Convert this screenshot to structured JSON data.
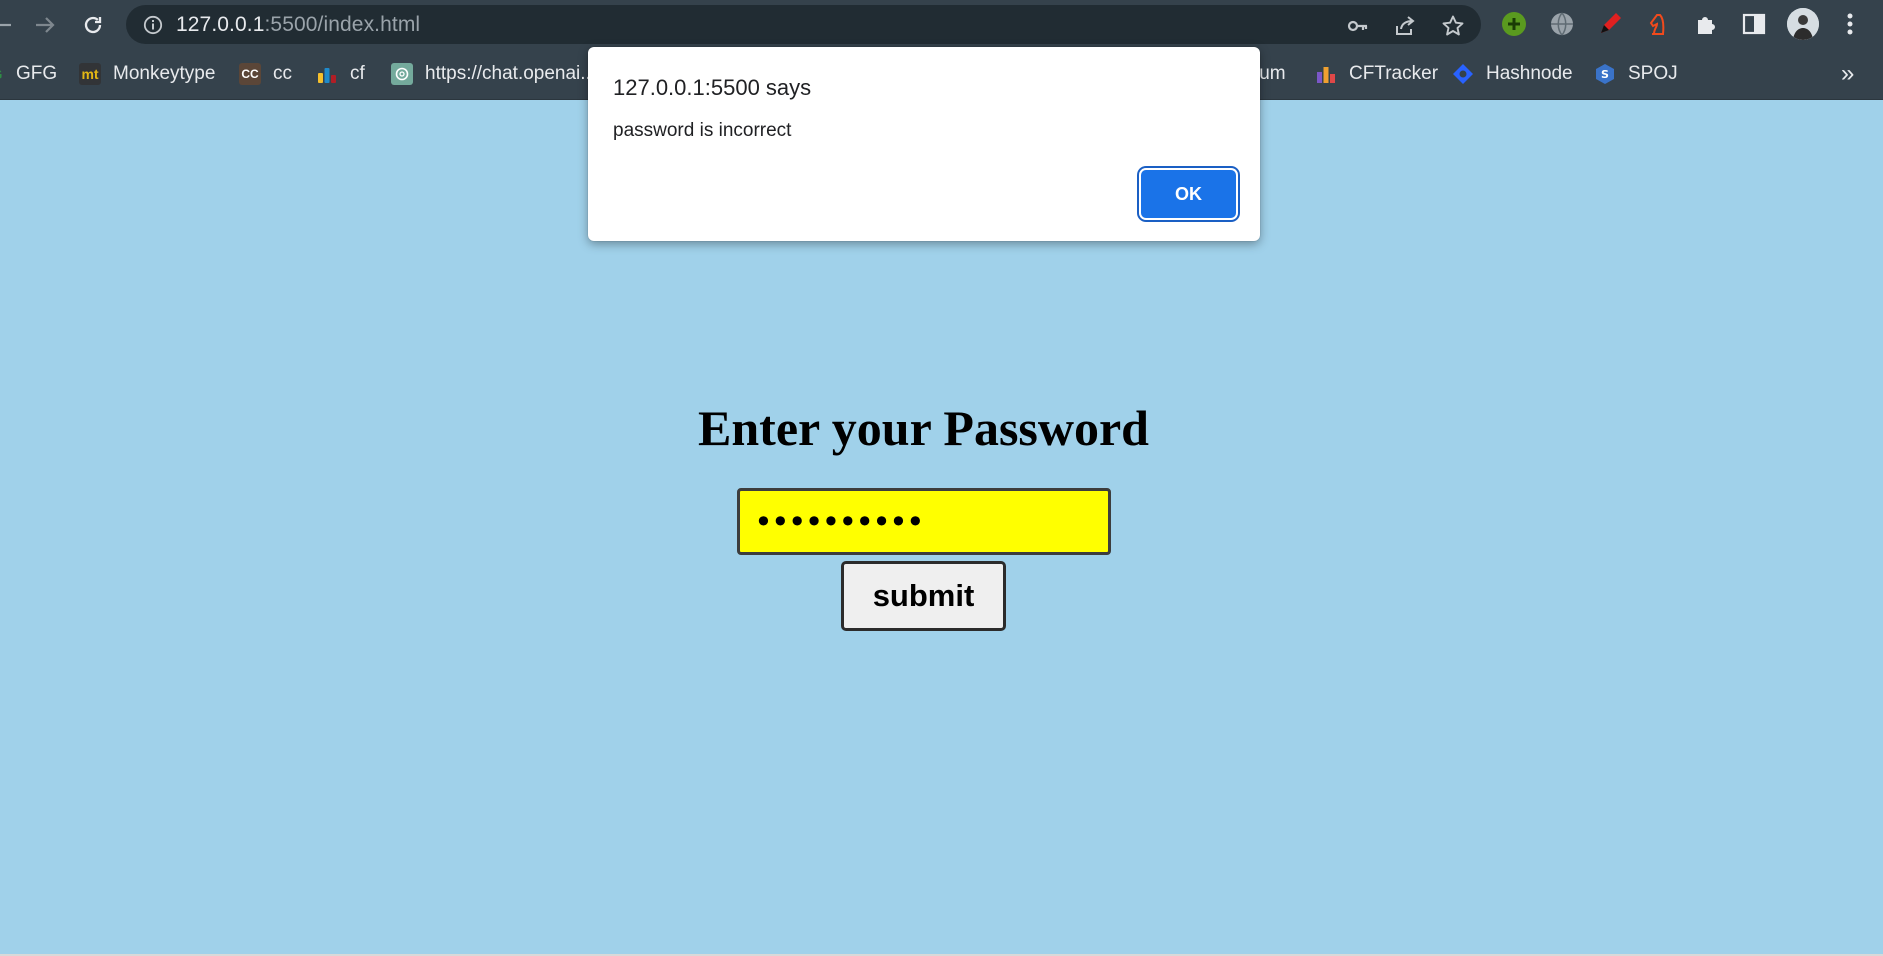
{
  "browser": {
    "url_host": "127.0.0.1",
    "url_rest": ":5500/index.html",
    "bookmarks": [
      {
        "label": "GFG",
        "icon": "gfg-icon",
        "color": "#2f8d46"
      },
      {
        "label": "Monkeytype",
        "icon": "monkeytype-icon",
        "fav_text": "mt",
        "color": "#323437"
      },
      {
        "label": "cc",
        "icon": "codechef-icon",
        "fav_text": "CC",
        "color": "#5b4638"
      },
      {
        "label": "cf",
        "icon": "codeforces-icon",
        "color": "#1f8acb"
      },
      {
        "label": "https://chat.openai...",
        "icon": "openai-icon",
        "color": "#74aa9c"
      },
      {
        "label": "ium",
        "icon": "medium-icon",
        "color": "#000000"
      },
      {
        "label": "CFTracker",
        "icon": "cftracker-icon",
        "color": "#f0a030"
      },
      {
        "label": "Hashnode",
        "icon": "hashnode-icon",
        "color": "#2962ff"
      },
      {
        "label": "SPOJ",
        "icon": "spoj-icon",
        "color": "#3a73c9"
      }
    ],
    "overflow_label": "»"
  },
  "dialog": {
    "title": "127.0.0.1:5500 says",
    "message": "password is incorrect",
    "ok_label": "OK"
  },
  "page": {
    "title": "Enter your Password",
    "password_value": "••••••••••",
    "submit_label": "submit",
    "colors": {
      "background": "#a0d1ea",
      "input": "#ffff00"
    }
  }
}
